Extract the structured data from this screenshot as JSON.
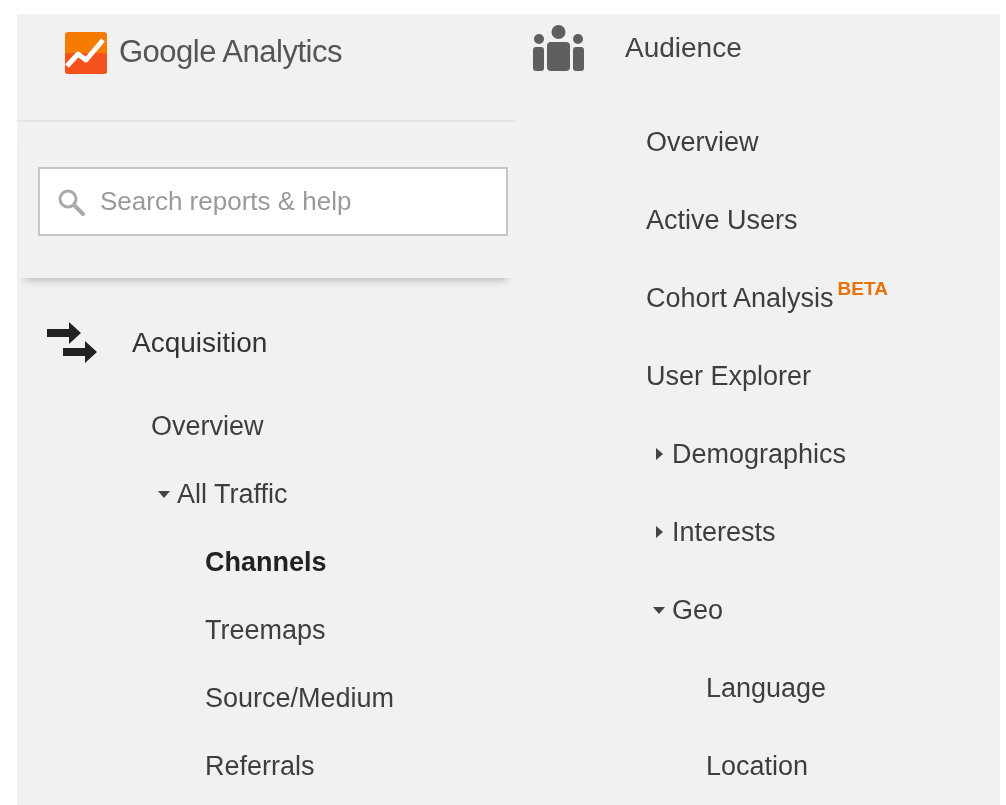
{
  "left_panel": {
    "logo_text": "Google Analytics",
    "search": {
      "placeholder": "Search reports & help"
    },
    "section": {
      "label": "Acquisition",
      "items": [
        {
          "label": "Overview",
          "selected": false
        },
        {
          "label": "All Traffic",
          "selected": false,
          "expanded": true,
          "children": [
            {
              "label": "Channels",
              "selected": true
            },
            {
              "label": "Treemaps",
              "selected": false
            },
            {
              "label": "Source/Medium",
              "selected": false
            },
            {
              "label": "Referrals",
              "selected": false
            }
          ]
        }
      ]
    }
  },
  "right_panel": {
    "section": {
      "label": "Audience",
      "items": [
        {
          "label": "Overview",
          "selected": false
        },
        {
          "label": "Active Users",
          "selected": false
        },
        {
          "label": "Cohort Analysis",
          "badge": "BETA",
          "selected": false
        },
        {
          "label": "User Explorer",
          "selected": false
        },
        {
          "label": "Demographics",
          "selected": false,
          "expanded": false
        },
        {
          "label": "Interests",
          "selected": false,
          "expanded": false
        },
        {
          "label": "Geo",
          "selected": false,
          "expanded": true,
          "children": [
            {
              "label": "Language",
              "selected": false
            },
            {
              "label": "Location",
              "selected": false
            }
          ]
        }
      ]
    }
  }
}
